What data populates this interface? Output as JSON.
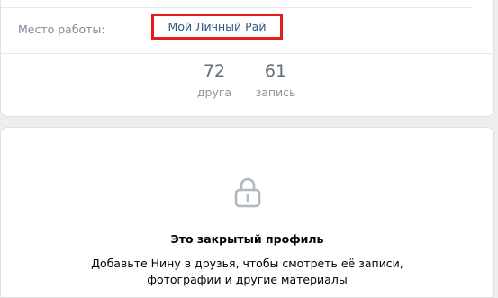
{
  "profile_info": {
    "work_label": "Место работы:",
    "work_value": "Мой Личный Рай"
  },
  "counters": [
    {
      "value": "72",
      "label": "друга"
    },
    {
      "value": "61",
      "label": "запись"
    }
  ],
  "closed_profile": {
    "icon": "lock-icon",
    "title": "Это закрытый профиль",
    "description_line1": "Добавьте Нину в друзья, чтобы смотреть её записи,",
    "description_line2": "фотографии и другие материалы"
  },
  "colors": {
    "link": "#2a5885",
    "highlight_border": "#e11c1c",
    "label_gray": "#818c99",
    "page_bg": "#edeef0"
  }
}
